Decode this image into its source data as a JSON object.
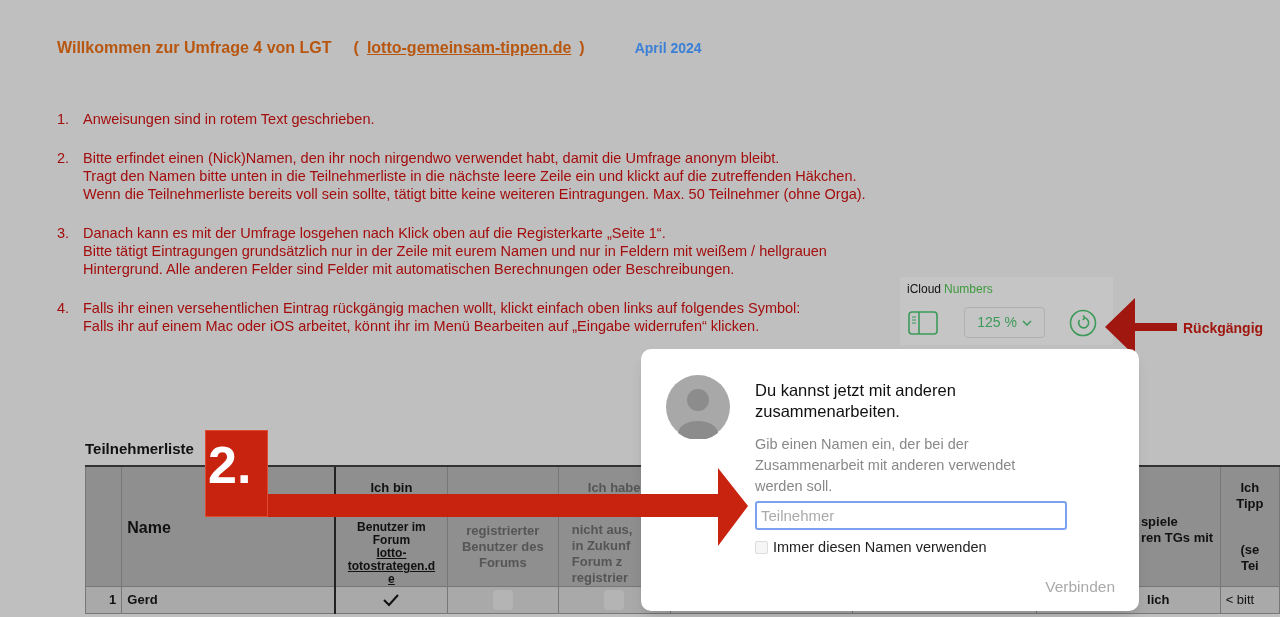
{
  "header": {
    "title": "Willkommen zur Umfrage 4 von LGT",
    "open_paren": "(",
    "link": "lotto-gemeinsam-tippen.de",
    "close_paren": ")",
    "date": "April 2024"
  },
  "instructions": [
    {
      "number": "1.",
      "lines": [
        "Anweisungen sind in rotem Text geschrieben."
      ]
    },
    {
      "number": "2.",
      "lines": [
        "Bitte erfindet einen (Nick)Namen, den ihr noch nirgendwo verwendet habt, damit die Umfrage anonym bleibt.",
        "Tragt den Namen bitte unten in die Teilnehmerliste in die nächste leere Zeile ein und klickt auf die zutreffenden Häkchen.",
        "Wenn die Teilnehmerliste bereits voll sein sollte, tätigt bitte keine weiteren Eintragungen. Max. 50 Teilnehmer (ohne Orga)."
      ]
    },
    {
      "number": "3.",
      "lines": [
        "Danach kann es mit der Umfrage losgehen nach Klick oben auf die Registerkarte „Seite 1“.",
        "Bitte tätigt Eintragungen grundsätzlich nur in der Zeile mit eurem Namen und nur in Feldern mit weißem / hellgrauen",
        "Hintergrund. Alle anderen Felder sind Felder mit automatischen Berechnungen oder Beschreibungen."
      ]
    },
    {
      "number": "4.",
      "lines": [
        "Falls ihr einen versehentlichen Eintrag rückgängig machen wollt, klickt einfach oben links auf folgendes Symbol:",
        "Falls ihr auf einem Mac oder iOS arbeitet, könnt ihr im Menü Bearbeiten auf „Eingabe widerrufen“ klicken."
      ]
    }
  ],
  "toolbar": {
    "brand": "iCloud",
    "app": "Numbers",
    "zoom": "125 %",
    "callout": "Rückgängig"
  },
  "table": {
    "title": "Teilnehmerliste",
    "callout": "2.",
    "columns": [
      {},
      {
        "label": "Name"
      },
      {
        "label": "Ich bin",
        "rest": "Benutzer im\nForum ",
        "link": "lotto-\ntotostrategen.d\ne"
      },
      {
        "rest": "registrierter\nBenutzer des\nForums"
      },
      {
        "label": "Ich habe",
        "rest": "nicht aus,\nin Zukunf\nForum z\nregistrier"
      },
      {},
      {},
      {
        "rest": "spiele\nren TGs mit"
      },
      {
        "label": "Ich\nTipp",
        "rest": "(se\nTei"
      }
    ],
    "rows": [
      {
        "number": "1",
        "name": "Gerd",
        "checks": [
          true,
          false,
          false
        ],
        "column_8": "lich",
        "column_9": "< bitt"
      }
    ]
  },
  "dialog": {
    "title": "Du kannst jetzt mit anderen zusammenarbeiten.",
    "description": "Gib einen Namen ein, der bei der Zusammenarbeit mit anderen verwendet werden soll.",
    "placeholder": "Teilnehmer",
    "remember": {
      "label": "Immer diesen Namen verwenden",
      "checked": false
    },
    "button": {
      "label": "Verbinden",
      "disabled": true
    }
  }
}
